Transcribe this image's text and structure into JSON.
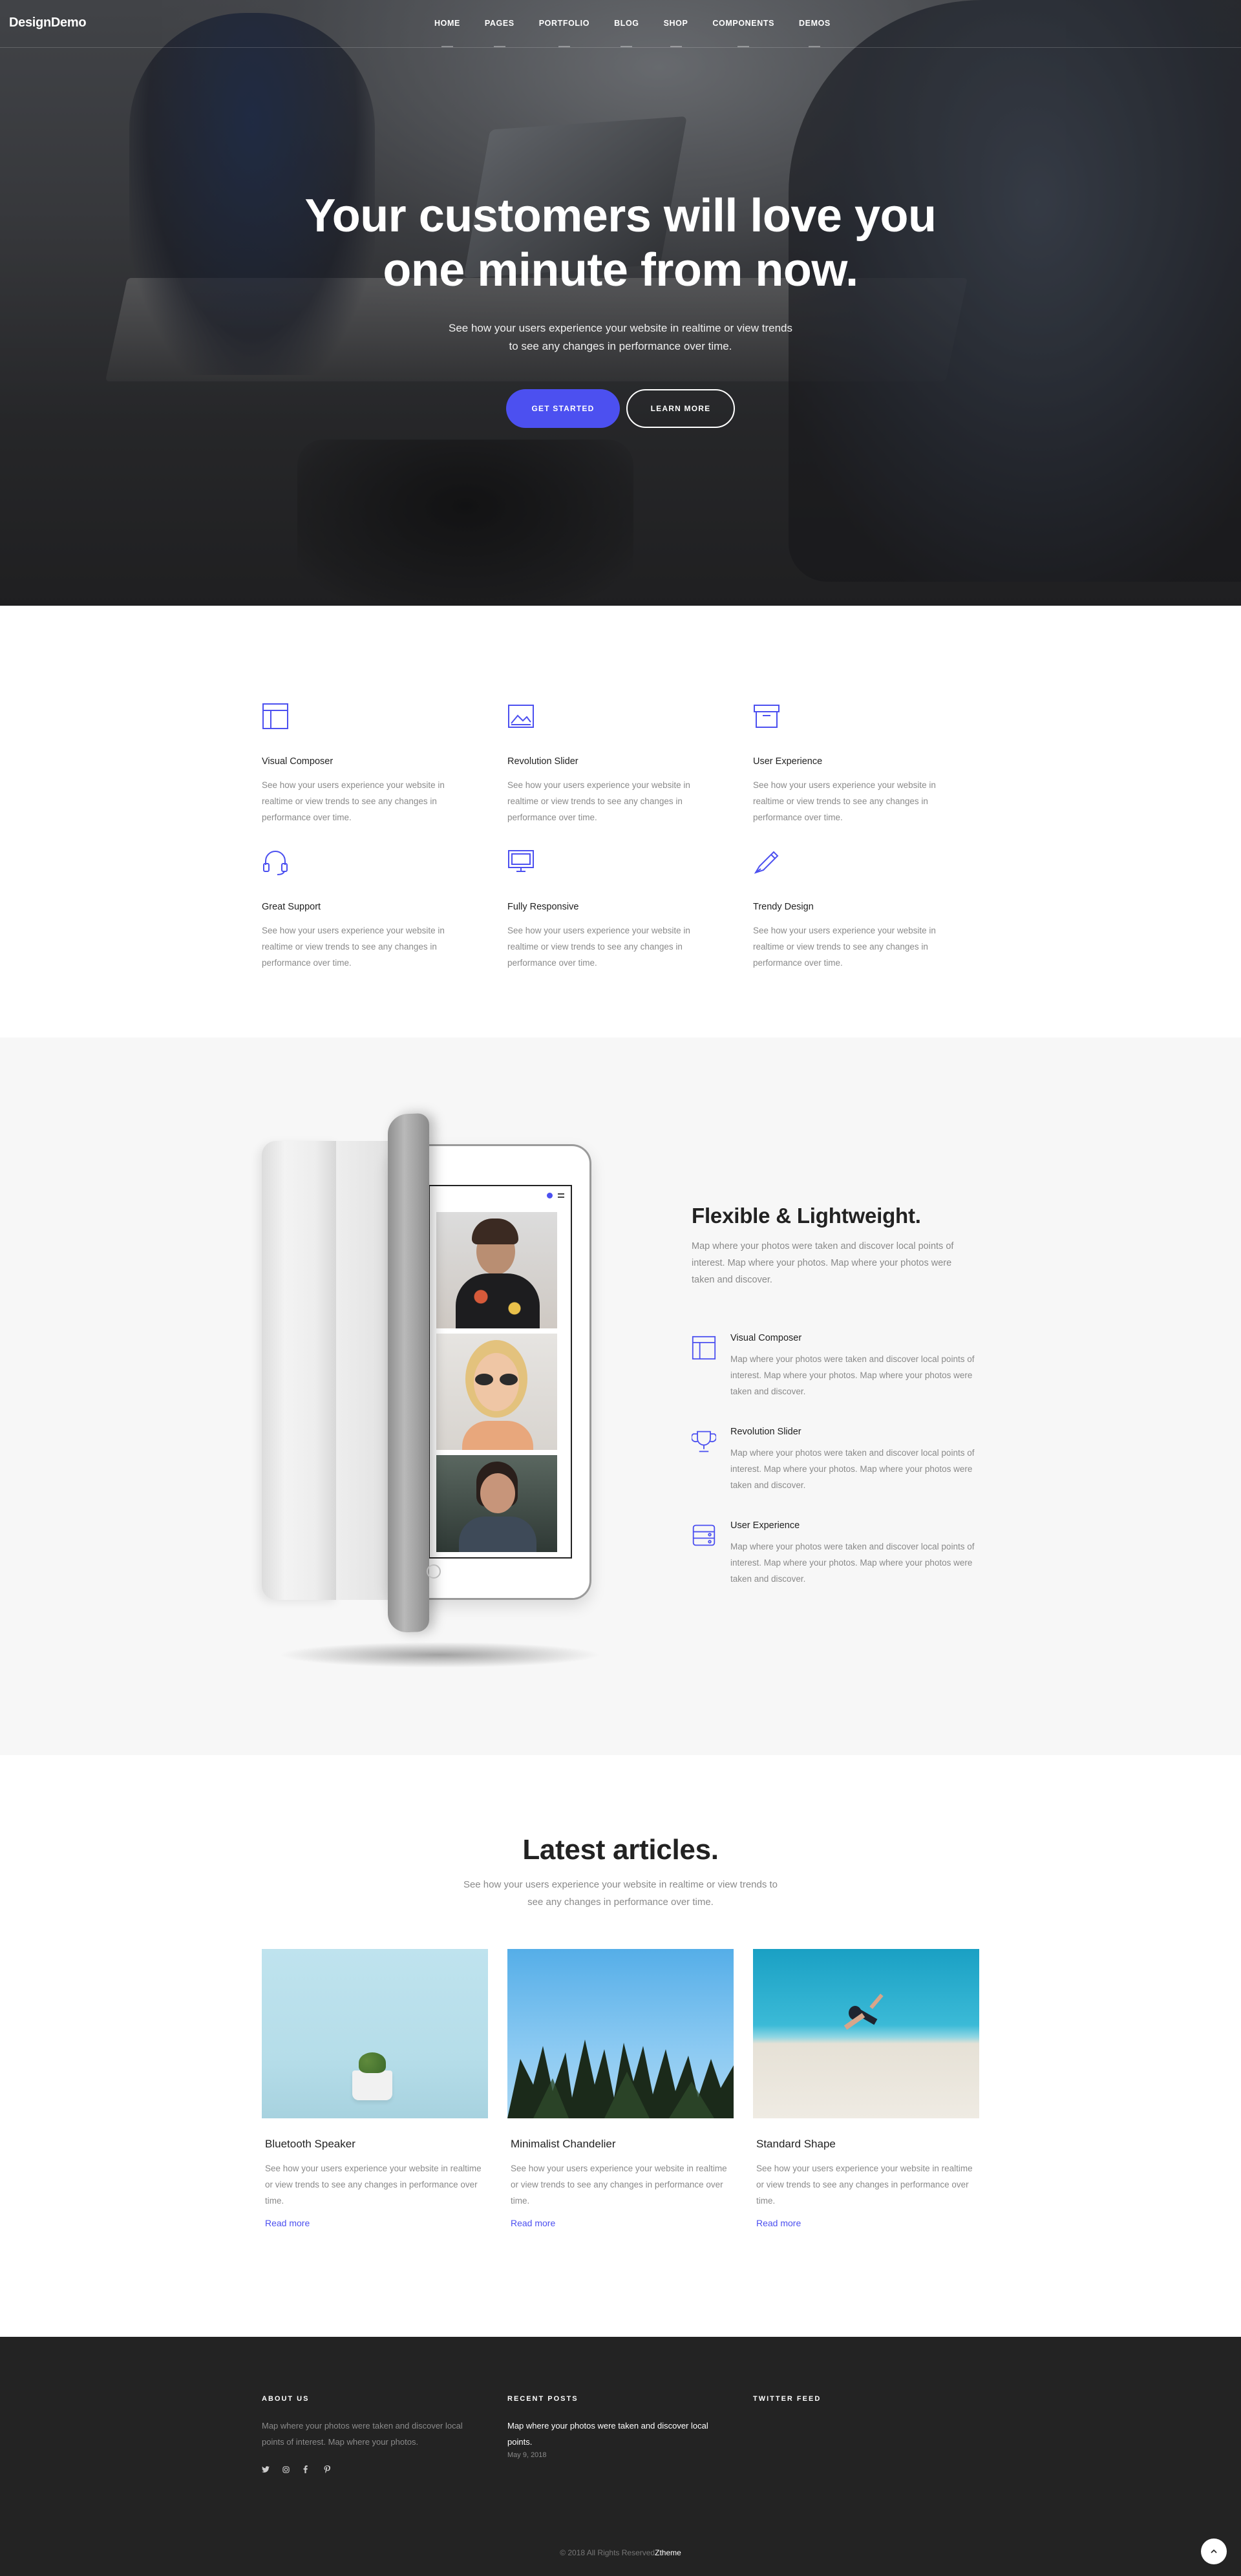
{
  "brand": {
    "logo": "DesignDemo",
    "accent": "#4c50f0"
  },
  "nav": {
    "items": [
      "HOME",
      "PAGES",
      "PORTFOLIO",
      "BLOG",
      "SHOP",
      "COMPONENTS",
      "DEMOS"
    ]
  },
  "hero": {
    "title_line1": "Your customers will love you",
    "title_line2": "one minute from now.",
    "subtitle": "See how your users experience your website in realtime or view trends to see any changes in performance over time.",
    "primary_button": "GET STARTED",
    "secondary_button": "LEARN MORE"
  },
  "features": [
    {
      "icon": "layout-icon",
      "title": "Visual Composer",
      "text": "See how your users experience your website in realtime or view trends to see any changes in performance over time."
    },
    {
      "icon": "image-icon",
      "title": "Revolution Slider",
      "text": "See how your users experience your website in realtime or view trends to see any changes in performance over time."
    },
    {
      "icon": "archive-box-icon",
      "title": "User Experience",
      "text": "See how your users experience your website in realtime or view trends to see any changes in performance over time."
    },
    {
      "icon": "headphones-icon",
      "title": "Great Support",
      "text": "See how your users experience your website in realtime or view trends to see any changes in performance over time."
    },
    {
      "icon": "monitor-icon",
      "title": "Fully Responsive",
      "text": "See how your users experience your website in realtime or view trends to see any changes in performance over time."
    },
    {
      "icon": "pen-icon",
      "title": "Trendy Design",
      "text": "See how your users experience your website in realtime or view trends to see any changes in performance over time."
    }
  ],
  "flex": {
    "title": "Flexible & Lightweight.",
    "subtitle": "Map where your photos were taken and discover local points of interest. Map where your photos. Map where your photos were taken and discover.",
    "items": [
      {
        "icon": "layout-icon",
        "title": "Visual Composer",
        "text": "Map where your photos were taken and discover local points of interest. Map where your photos. Map where your photos were taken and discover."
      },
      {
        "icon": "trophy-icon",
        "title": "Revolution Slider",
        "text": "Map where your photos were taken and discover local points of interest. Map where your photos. Map where your photos were taken and discover."
      },
      {
        "icon": "server-icon",
        "title": "User Experience",
        "text": "Map where your photos were taken and discover local points of interest. Map where your photos. Map where your photos were taken and discover."
      }
    ]
  },
  "articles": {
    "title": "Latest articles.",
    "subtitle": "See how your users experience your website in realtime or view trends to see any changes in performance over time.",
    "cards": [
      {
        "title": "Bluetooth Speaker",
        "text": "See how your users experience your website in realtime or view trends to see any changes in performance over time.",
        "link": "Read more"
      },
      {
        "title": "Minimalist Chandelier",
        "text": "See how your users experience your website in realtime or view trends to see any changes in performance over time.",
        "link": "Read more"
      },
      {
        "title": "Standard Shape",
        "text": "See how your users experience your website in realtime or view trends to see any changes in performance over time.",
        "link": "Read more"
      }
    ]
  },
  "footer": {
    "about_heading": "ABOUT US",
    "about_text": "Map where your photos were taken and discover local points of interest. Map where your photos.",
    "recent_heading": "RECENT POSTS",
    "recent_post": "Map where your photos were taken and discover local points.",
    "recent_date": "May 9, 2018",
    "twitter_heading": "TWITTER FEED",
    "social": [
      "twitter-icon",
      "instagram-icon",
      "facebook-icon",
      "pinterest-icon"
    ],
    "copyright": "© 2018 All Rights Reserved",
    "copyright_brand": "Ztheme"
  }
}
